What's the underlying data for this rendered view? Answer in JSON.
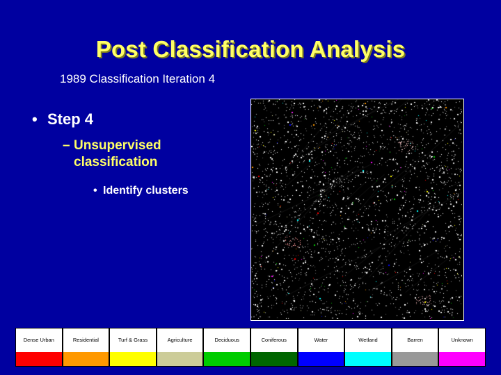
{
  "slide": {
    "title": "Post Classification Analysis",
    "subtitle": "1989 Classification Iteration 4",
    "bullets": {
      "level1": "Step 4",
      "level2_line1": "Unsupervised",
      "level2_line2": "classification",
      "level3": "Identify clusters",
      "marker_l1": "•",
      "marker_l2": "–",
      "marker_l3": "•"
    },
    "background_color": "#0000a0",
    "title_color": "#ffff66",
    "text_color": "#ffffff"
  },
  "classified_image": {
    "name": "classified-satellite-image",
    "background_color": "#000000",
    "border_color": "#ffffff"
  },
  "legend": {
    "items": [
      {
        "label": "Dense Urban",
        "color": "#ff0000"
      },
      {
        "label": "Residential",
        "color": "#ff9900"
      },
      {
        "label": "Turf & Grass",
        "color": "#ffff00"
      },
      {
        "label": "Agriculture",
        "color": "#cccc99"
      },
      {
        "label": "Deciduous",
        "color": "#00cc00"
      },
      {
        "label": "Coniferous",
        "color": "#006600"
      },
      {
        "label": "Water",
        "color": "#0000ff"
      },
      {
        "label": "Wetland",
        "color": "#00ffff"
      },
      {
        "label": "Barren",
        "color": "#999999"
      },
      {
        "label": "Unknown",
        "color": "#ff00ff"
      }
    ]
  }
}
